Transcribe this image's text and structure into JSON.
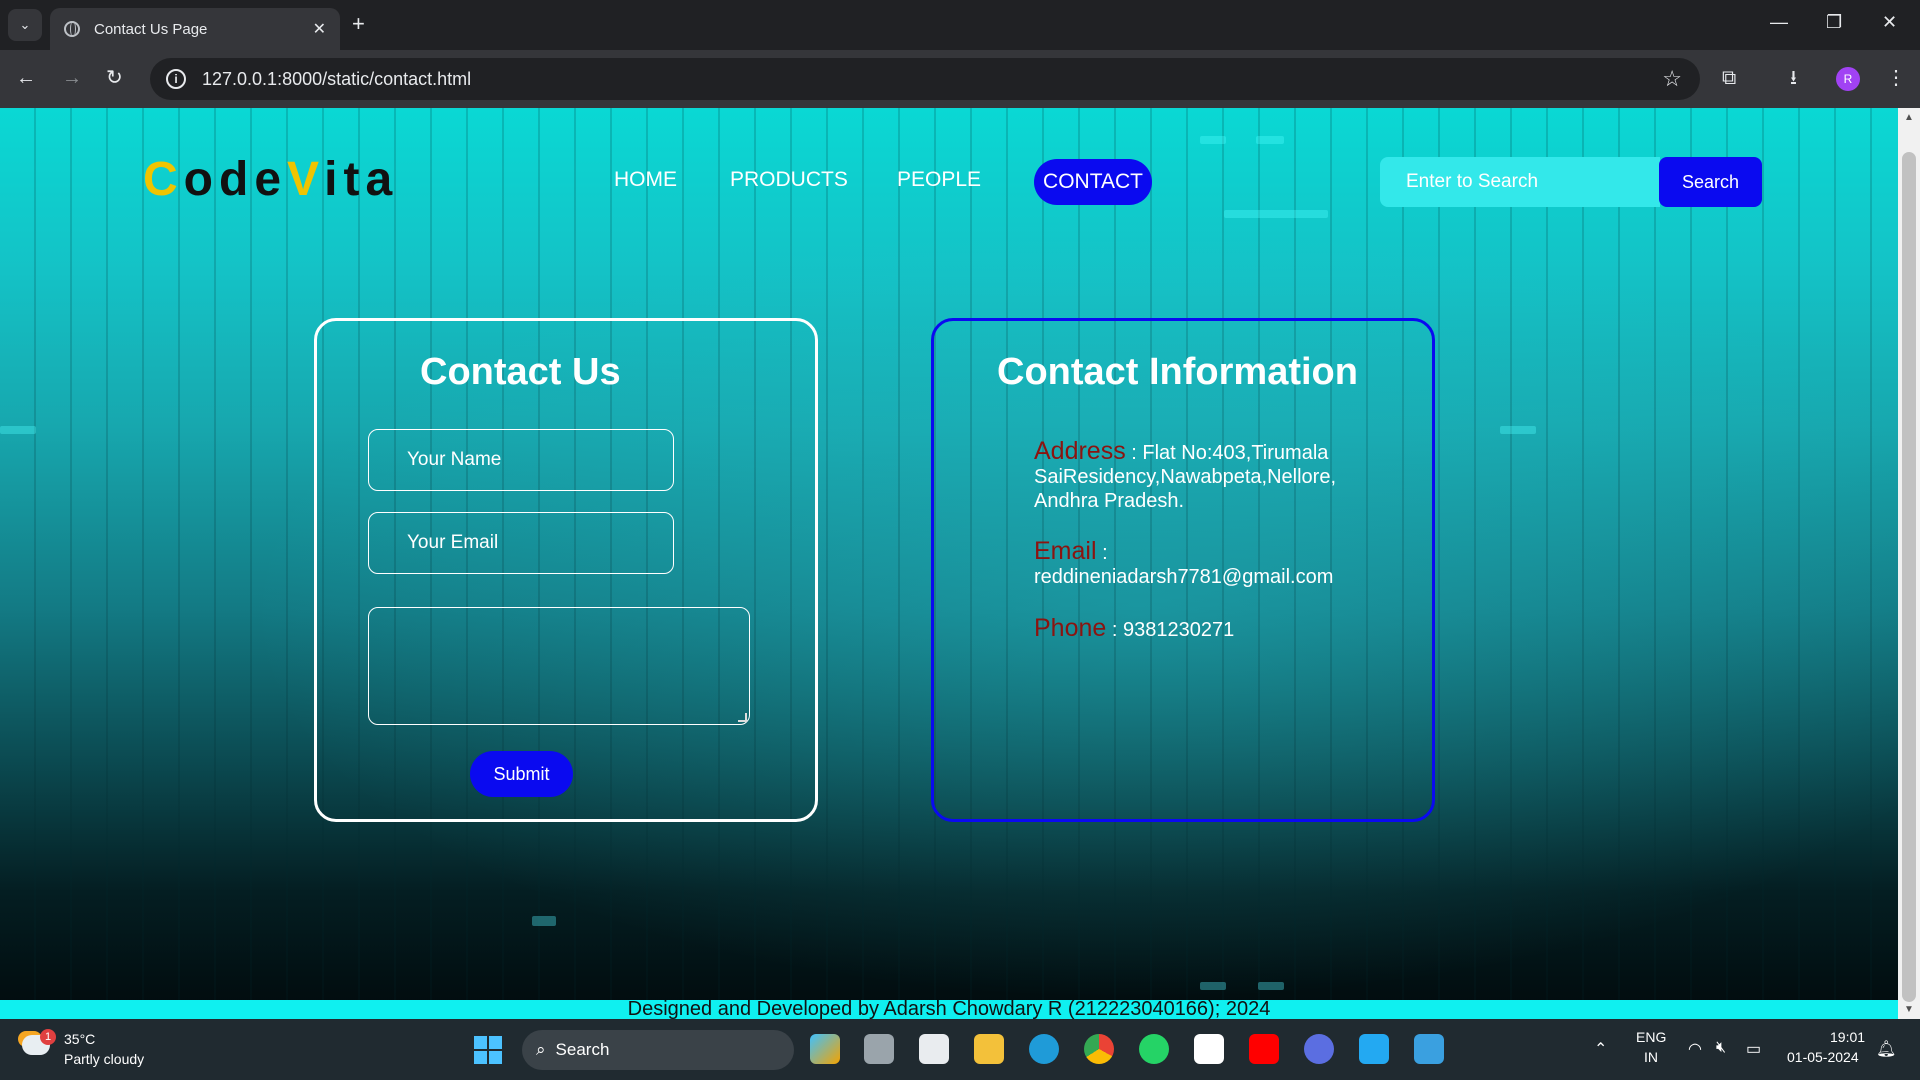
{
  "browser": {
    "tab_title": "Contact Us Page",
    "tab_close": "✕",
    "new_tab": "+",
    "url": "127.0.0.1:8000/static/contact.html",
    "profile_initial": "R"
  },
  "site": {
    "logo": {
      "c1": "C",
      "p1": "ode",
      "c2": "V",
      "p2": "ita"
    },
    "nav": [
      "HOME",
      "PRODUCTS",
      "PEOPLE",
      "CONTACT"
    ],
    "active_nav": "CONTACT",
    "search": {
      "placeholder": "Enter to Search",
      "button": "Search"
    },
    "contact_form": {
      "title": "Contact Us",
      "name_placeholder": "Your Name",
      "email_placeholder": "Your Email",
      "submit": "Submit"
    },
    "contact_info": {
      "title": "Contact Information",
      "address_label": "Address",
      "address_value": " : Flat No:403,Tirumala SaiResidency,Nawabpeta,Nellore, Andhra Pradesh.",
      "email_label": "Email",
      "email_sep": " :",
      "email_value": "reddineniadarsh7781@gmail.com",
      "phone_label": "Phone",
      "phone_value": " : 9381230271"
    },
    "footer": "Designed and Developed by Adarsh Chowdary R (212223040166); 2024"
  },
  "taskbar": {
    "weather_temp": "35°C",
    "weather_desc": "Partly cloudy",
    "weather_badge": "1",
    "search_label": "Search",
    "lang": "ENG",
    "region": "IN",
    "time": "19:01",
    "date": "01-05-2024"
  },
  "colors": {
    "accent_blue": "#0a0af0",
    "logo_yellow": "#f0c400",
    "label_red": "#8b1410",
    "footer_cyan": "#0ff0f0"
  }
}
